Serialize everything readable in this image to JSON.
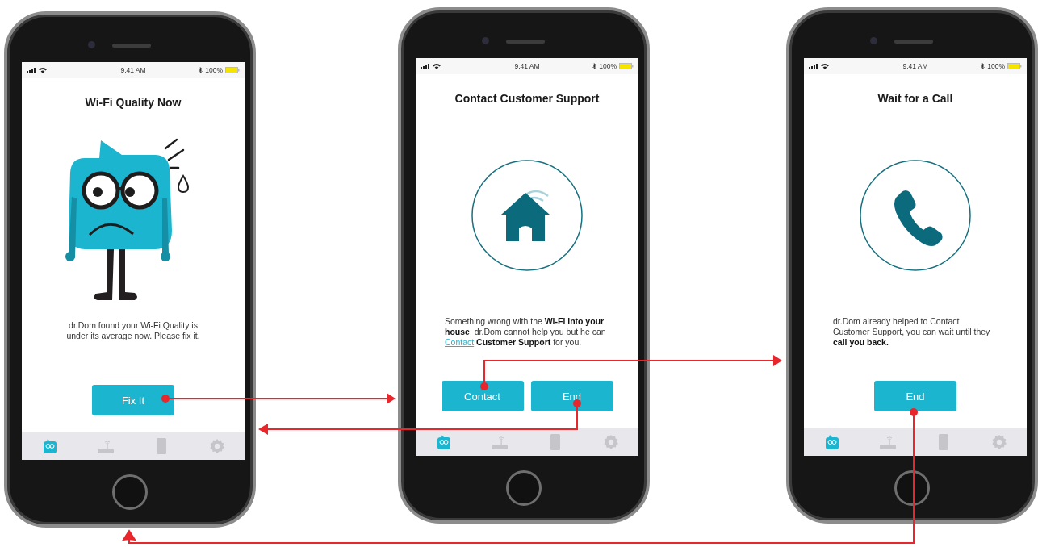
{
  "screens": [
    {
      "status_bar": {
        "time": "9:41 AM",
        "battery": "100%"
      },
      "title": "Wi-Fi Quality Now",
      "illustration": {
        "kind": "mascot"
      },
      "message": [
        {
          "kind": "text",
          "text": "dr.Dom found your Wi-Fi Quality is under its average now. Please fix it."
        }
      ],
      "buttons": [
        "Fix It"
      ],
      "tabs": [
        {
          "kind": "mascot",
          "selected": true
        },
        {
          "kind": "router",
          "selected": false
        },
        {
          "kind": "device",
          "selected": false
        },
        {
          "kind": "settings",
          "selected": false
        }
      ]
    },
    {
      "status_bar": {
        "time": "9:41 AM",
        "battery": "100%"
      },
      "title": "Contact Customer Support",
      "illustration": {
        "kind": "house"
      },
      "message": [
        {
          "kind": "text",
          "text": "Something wrong with the **Wi-Fi into your house**, dr.Dom cannot help you but he can "
        },
        {
          "kind": "link",
          "text": "Contact"
        },
        {
          "kind": "text",
          "text": " **Customer Support** for you."
        }
      ],
      "buttons": [
        "Contact",
        "End"
      ],
      "tabs": [
        {
          "kind": "mascot",
          "selected": true
        },
        {
          "kind": "router",
          "selected": false
        },
        {
          "kind": "device",
          "selected": false
        },
        {
          "kind": "settings",
          "selected": false
        }
      ]
    },
    {
      "status_bar": {
        "time": "9:41 AM",
        "battery": "100%"
      },
      "title": "Wait for a Call",
      "illustration": {
        "kind": "phone"
      },
      "message": [
        {
          "kind": "text",
          "text": "dr.Dom already helped to Contact Customer Support, you can wait until they **call you back.**"
        }
      ],
      "buttons": [
        "End"
      ],
      "tabs": [
        {
          "kind": "mascot",
          "selected": true
        },
        {
          "kind": "router",
          "selected": false
        },
        {
          "kind": "device",
          "selected": false
        },
        {
          "kind": "settings",
          "selected": false
        }
      ]
    }
  ]
}
